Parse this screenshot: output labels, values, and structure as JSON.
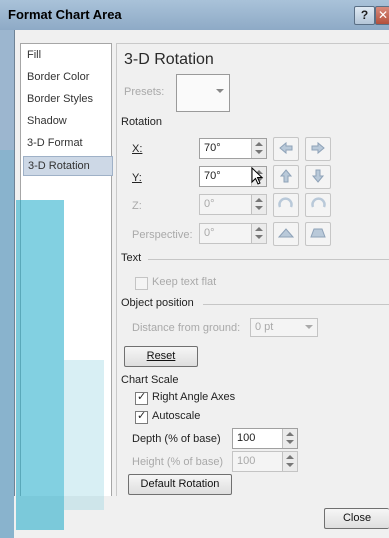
{
  "window": {
    "title": "Format Chart Area",
    "help_label": "?",
    "close_glyph": "✕"
  },
  "nav": {
    "items": [
      {
        "label": "Fill"
      },
      {
        "label": "Border Color"
      },
      {
        "label": "Border Styles"
      },
      {
        "label": "Shadow"
      },
      {
        "label": "3-D Format"
      },
      {
        "label": "3-D Rotation",
        "selected": true
      }
    ]
  },
  "panel": {
    "heading": "3-D Rotation",
    "presets_label": "Presets:",
    "rotation": {
      "section": "Rotation",
      "x": {
        "label": "X:",
        "value": "70°"
      },
      "y": {
        "label": "Y:",
        "value": "70°"
      },
      "z": {
        "label": "Z:",
        "value": "0°"
      },
      "perspective": {
        "label": "Perspective:",
        "value": "0°"
      }
    },
    "text": {
      "section": "Text",
      "keep_flat_label": "Keep text flat"
    },
    "object_position": {
      "section": "Object position",
      "distance_label": "Distance from ground:",
      "distance_value": "0 pt"
    },
    "reset_label": "Reset",
    "chart_scale": {
      "section": "Chart Scale",
      "right_angle_label": "Right Angle Axes",
      "right_angle_checked": true,
      "autoscale_label": "Autoscale",
      "autoscale_checked": true,
      "depth_label": "Depth (% of base)",
      "depth_value": "100",
      "height_label": "Height (% of base)",
      "height_value": "100"
    },
    "default_rotation_label": "Default Rotation"
  },
  "footer": {
    "close_label": "Close"
  },
  "colors": {
    "title_bar": "#9cb6cf",
    "selected_nav": "#cdd8e6"
  }
}
